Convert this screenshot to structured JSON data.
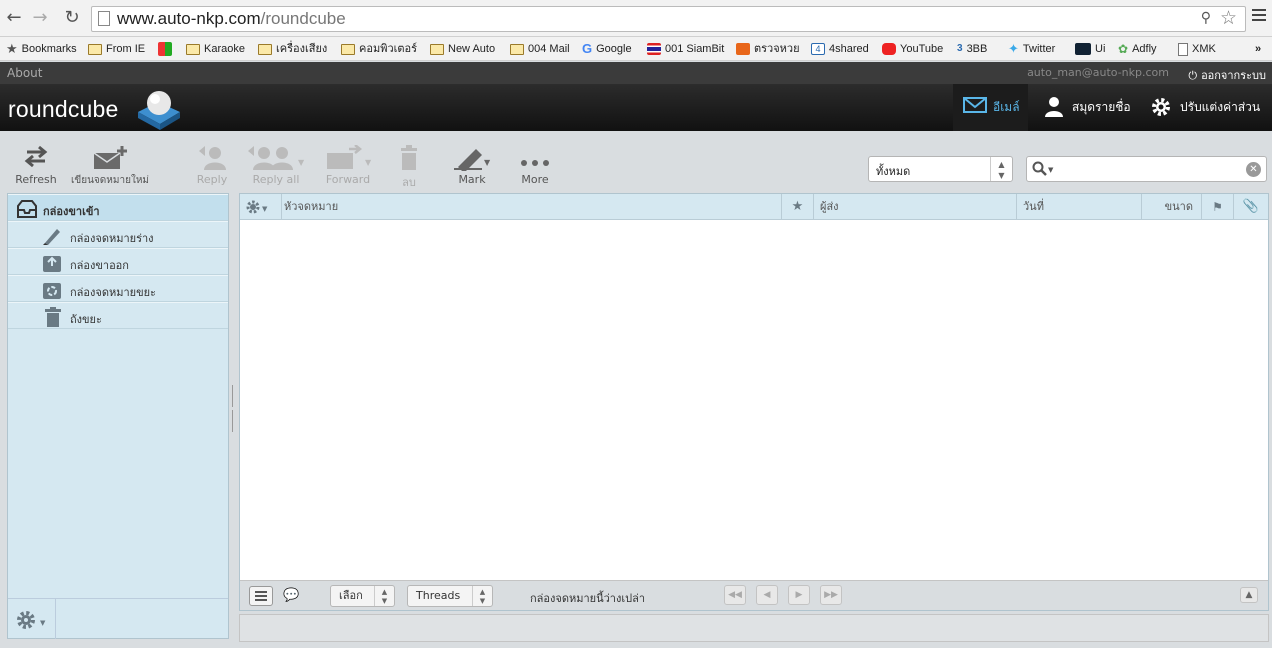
{
  "browser": {
    "url_host": "www.auto-nkp.com",
    "url_path": "/roundcube",
    "bookmarks": [
      {
        "label": "Bookmarks",
        "icon": "star-icon"
      },
      {
        "label": "From IE",
        "icon": "folder-icon"
      },
      {
        "label": "",
        "icon": "colorful-app-icon"
      },
      {
        "label": "Karaoke",
        "icon": "folder-icon"
      },
      {
        "label": "เครื่องเสียง",
        "icon": "folder-icon"
      },
      {
        "label": "คอมพิวเตอร์",
        "icon": "folder-icon"
      },
      {
        "label": "New Auto",
        "icon": "folder-icon"
      },
      {
        "label": "004 Mail",
        "icon": "folder-icon"
      },
      {
        "label": "Google",
        "icon": "google-icon"
      },
      {
        "label": "001 SiamBit",
        "icon": "thai-flag-icon"
      },
      {
        "label": "ตรวจหวย",
        "icon": "orange-m-icon"
      },
      {
        "label": "4shared",
        "icon": "4shared-icon"
      },
      {
        "label": "YouTube",
        "icon": "youtube-icon"
      },
      {
        "label": "3BB",
        "icon": "3bb-icon"
      },
      {
        "label": "Twitter",
        "icon": "twitter-icon"
      },
      {
        "label": "Ui",
        "icon": "ui-icon"
      },
      {
        "label": "Adfly",
        "icon": "adfly-icon"
      },
      {
        "label": "XMK",
        "icon": "page-icon"
      }
    ]
  },
  "topline": {
    "about": "About",
    "user": "auto_man@auto-nkp.com",
    "logout": "ออกจากระบบ"
  },
  "header": {
    "logo": "roundcube",
    "tasks": {
      "mail": "อีเมล์",
      "contacts": "สมุดรายชื่อ",
      "settings": "ปรับแต่งค่าส่วนตัว"
    }
  },
  "toolbar": {
    "refresh": "Refresh",
    "compose": "เขียนจดหมายใหม่",
    "reply": "Reply",
    "reply_all": "Reply all",
    "forward": "Forward",
    "delete": "ลบ",
    "mark": "Mark",
    "more": "More",
    "filter_value": "ทั้งหมด"
  },
  "folders": [
    {
      "label": "กล่องขาเข้า",
      "icon": "inbox-icon",
      "selected": true
    },
    {
      "label": "กล่องจดหมายร่าง",
      "icon": "pencil-icon",
      "selected": false
    },
    {
      "label": "กล่องขาออก",
      "icon": "sent-icon",
      "selected": false
    },
    {
      "label": "กล่องจดหมายขยะ",
      "icon": "junk-icon",
      "selected": false
    },
    {
      "label": "ถังขยะ",
      "icon": "trash-icon",
      "selected": false
    }
  ],
  "messagelist": {
    "columns": {
      "subject": "หัวจดหมาย",
      "from": "ผู้ส่ง",
      "date": "วันที่",
      "size": "ขนาด"
    },
    "footer": {
      "select": "เลือก",
      "threads": "Threads",
      "count": "กล่องจดหมายนี้ว่างเปล่า"
    }
  },
  "colors": {
    "accent": "#5ab6e8",
    "panel": "#d5e8f1",
    "header": "#1a1a1a"
  }
}
